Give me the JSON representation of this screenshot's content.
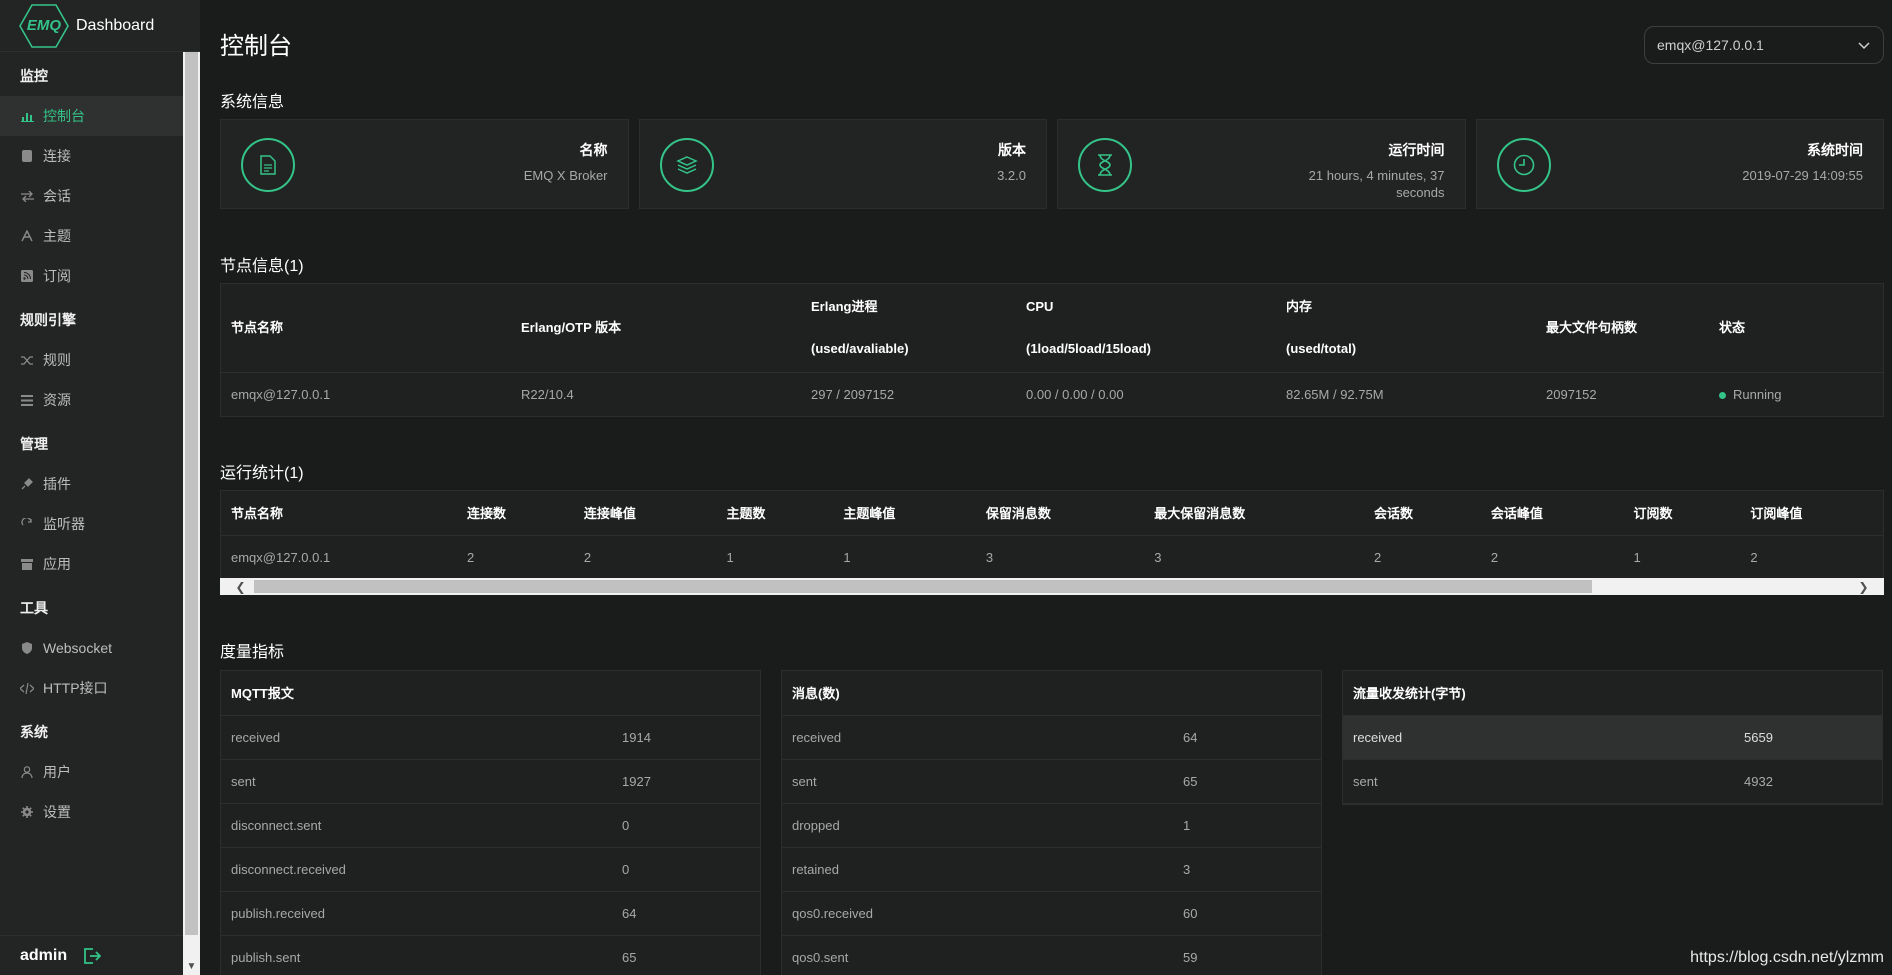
{
  "brand": {
    "logo": "EMQ",
    "title": "Dashboard"
  },
  "sidebar": {
    "groups": [
      {
        "title": "监控",
        "items": [
          {
            "label": "控制台",
            "icon": "bar-chart-icon",
            "active": true
          },
          {
            "label": "连接",
            "icon": "database-icon"
          },
          {
            "label": "会话",
            "icon": "swap-icon"
          },
          {
            "label": "主题",
            "icon": "topic-icon"
          },
          {
            "label": "订阅",
            "icon": "rss-icon"
          }
        ]
      },
      {
        "title": "规则引擎",
        "items": [
          {
            "label": "规则",
            "icon": "shuffle-icon"
          },
          {
            "label": "资源",
            "icon": "list-icon"
          }
        ]
      },
      {
        "title": "管理",
        "items": [
          {
            "label": "插件",
            "icon": "plug-icon"
          },
          {
            "label": "监听器",
            "icon": "refresh-icon"
          },
          {
            "label": "应用",
            "icon": "box-icon"
          }
        ]
      },
      {
        "title": "工具",
        "items": [
          {
            "label": "Websocket",
            "icon": "shield-icon"
          },
          {
            "label": "HTTP接口",
            "icon": "code-icon"
          }
        ]
      },
      {
        "title": "系统",
        "items": [
          {
            "label": "用户",
            "icon": "user-icon"
          },
          {
            "label": "设置",
            "icon": "gear-icon"
          }
        ]
      }
    ],
    "user": "admin"
  },
  "header": {
    "title": "控制台",
    "node_select": "emqx@127.0.0.1"
  },
  "system_info": {
    "title": "系统信息",
    "cards": [
      {
        "label": "名称",
        "value": "EMQ X Broker",
        "icon": "document-icon"
      },
      {
        "label": "版本",
        "value": "3.2.0",
        "icon": "layers-icon"
      },
      {
        "label": "运行时间",
        "value": "21 hours, 4 minutes, 37 seconds",
        "icon": "hourglass-icon"
      },
      {
        "label": "系统时间",
        "value": "2019-07-29 14:09:55",
        "icon": "clock-icon"
      }
    ]
  },
  "nodes": {
    "title": "节点信息(1)",
    "headers": {
      "name": "节点名称",
      "otp": "Erlang/OTP 版本",
      "proc": "Erlang进程",
      "proc_sub": "(used/avaliable)",
      "cpu": "CPU",
      "cpu_sub": "(1load/5load/15load)",
      "mem": "内存",
      "mem_sub": "(used/total)",
      "fds": "最大文件句柄数",
      "status": "状态"
    },
    "row": {
      "name": "emqx@127.0.0.1",
      "otp": "R22/10.4",
      "proc": "297 / 2097152",
      "cpu": "0.00 / 0.00 / 0.00",
      "mem": "82.65M / 92.75M",
      "fds": "2097152",
      "status": "Running"
    }
  },
  "stats": {
    "title": "运行统计(1)",
    "headers": [
      "节点名称",
      "连接数",
      "连接峰值",
      "主题数",
      "主题峰值",
      "保留消息数",
      "最大保留消息数",
      "会话数",
      "会话峰值",
      "订阅数",
      "订阅峰值"
    ],
    "row": [
      "emqx@127.0.0.1",
      "2",
      "2",
      "1",
      "1",
      "3",
      "3",
      "2",
      "2",
      "1",
      "2"
    ]
  },
  "metrics": {
    "title": "度量指标",
    "tables": [
      {
        "title": "MQTT报文",
        "rows": [
          {
            "k": "received",
            "v": "1914"
          },
          {
            "k": "sent",
            "v": "1927"
          },
          {
            "k": "disconnect.sent",
            "v": "0"
          },
          {
            "k": "disconnect.received",
            "v": "0"
          },
          {
            "k": "publish.received",
            "v": "64"
          },
          {
            "k": "publish.sent",
            "v": "65"
          }
        ]
      },
      {
        "title": "消息(数)",
        "rows": [
          {
            "k": "received",
            "v": "64"
          },
          {
            "k": "sent",
            "v": "65"
          },
          {
            "k": "dropped",
            "v": "1"
          },
          {
            "k": "retained",
            "v": "3"
          },
          {
            "k": "qos0.received",
            "v": "60"
          },
          {
            "k": "qos0.sent",
            "v": "59"
          }
        ]
      },
      {
        "title": "流量收发统计(字节)",
        "rows": [
          {
            "k": "received",
            "v": "5659"
          },
          {
            "k": "sent",
            "v": "4932"
          }
        ]
      }
    ]
  },
  "watermark": "https://blog.csdn.net/ylzmm",
  "colors": {
    "accent": "#34c388",
    "background": "#1a1b1b",
    "sidebar": "#232424"
  }
}
